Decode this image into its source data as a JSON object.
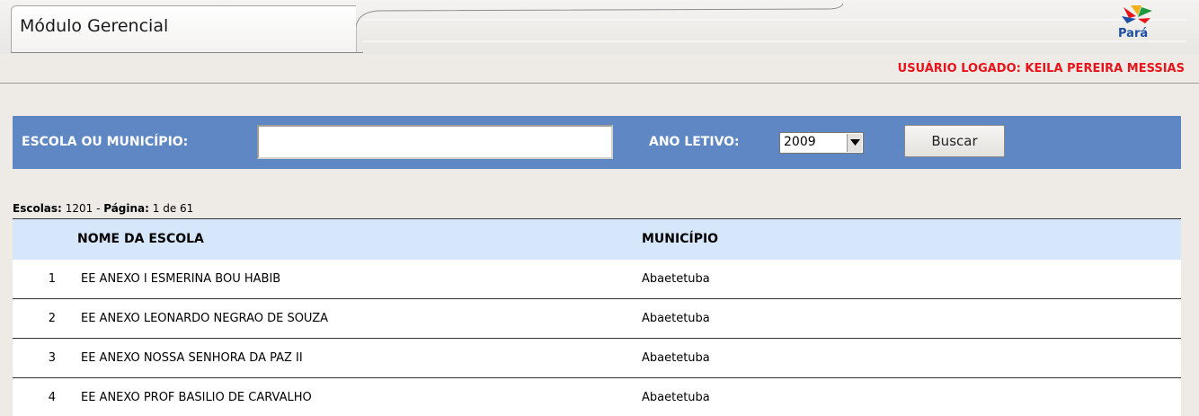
{
  "header": {
    "title": "Módulo Gerencial",
    "logo_text": "Pará"
  },
  "userbar": {
    "user_logged": "USUÁRIO LOGADO: KEILA PEREIRA MESSIAS"
  },
  "search": {
    "school_label": "ESCOLA OU MUNICÍPIO:",
    "school_value": "",
    "year_label": "ANO LETIVO:",
    "year_value": "2009",
    "button_label": "Buscar"
  },
  "summary": {
    "schools_label": "Escolas:",
    "schools_count": "1201",
    "separator": "-",
    "page_label": "Página:",
    "page_value": "1 de 61"
  },
  "table": {
    "headers": {
      "name": "NOME DA ESCOLA",
      "city": "MUNICÍPIO"
    },
    "rows": [
      {
        "num": "1",
        "name": "EE ANEXO I ESMERINA BOU HABIB",
        "city": "Abaetetuba"
      },
      {
        "num": "2",
        "name": "EE ANEXO LEONARDO NEGRAO DE SOUZA",
        "city": "Abaetetuba"
      },
      {
        "num": "3",
        "name": "EE ANEXO NOSSA SENHORA DA PAZ II",
        "city": "Abaetetuba"
      },
      {
        "num": "4",
        "name": "EE ANEXO PROF BASILIO DE CARVALHO",
        "city": "Abaetetuba"
      }
    ]
  },
  "colors": {
    "search_bar": "#5f87c4",
    "table_header": "#d6e6fb",
    "user_logged_text": "#e8141b",
    "background": "#eeebe7"
  }
}
